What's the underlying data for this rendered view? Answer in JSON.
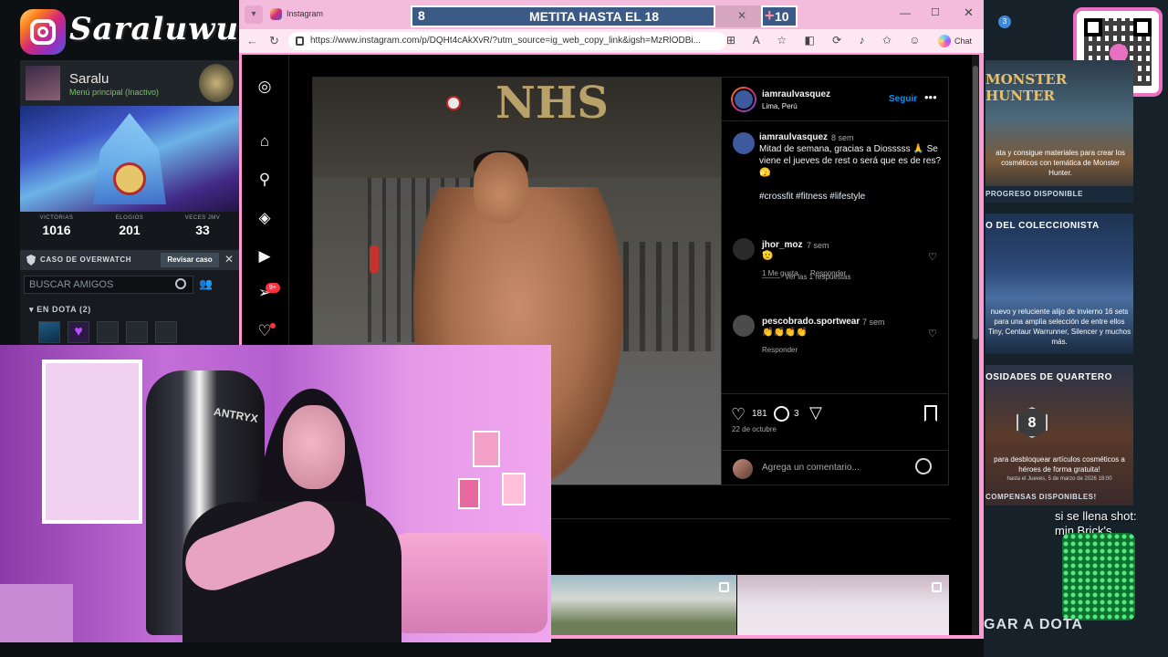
{
  "streamer": {
    "name": "Saraluwux"
  },
  "dota": {
    "profile_name": "Saralu",
    "status": "Menú principal (Inactivo)",
    "stats": [
      {
        "label": "VICTORIAS",
        "value": "1016"
      },
      {
        "label": "ELOGIOS",
        "value": "201"
      },
      {
        "label": "VECES JMV",
        "value": "33"
      }
    ],
    "overwatch_label": "CASO DE OVERWATCH",
    "overwatch_button": "Revisar caso",
    "search_placeholder": "BUSCAR AMIGOS",
    "friend_group": "EN DOTA (2)"
  },
  "counter": {
    "current": "8",
    "title": "METITA HASTA EL 18",
    "goal": "10",
    "close": "✕",
    "plus": "+"
  },
  "browser": {
    "tab_title": "Instagram",
    "url": "https://www.instagram.com/p/DQHt4cAkXvR/?utm_source=ig_web_copy_link&igsh=MzRlODBi...",
    "copilot_label": "Chat"
  },
  "post": {
    "username": "iamraulvasquez",
    "location": "Lima, Perú",
    "follow_label": "Seguir",
    "caption_user": "iamraulvasquez",
    "caption_time": "8 sem",
    "caption_text": "Mitad de semana, gracias a Diosssss 🙏 Se viene el jueves de rest o será que es de res? 🫣",
    "caption_tags": "#crossfit #fitness #lifestyle",
    "comments": [
      {
        "user": "jhor_moz",
        "time": "7 sem",
        "text": "🫡",
        "likes": "1 Me gusta",
        "reply": "Responder",
        "replies": "Ver las 1 respuestas"
      },
      {
        "user": "pescobrado.sportwear",
        "time": "7 sem",
        "text": "👏👏👏👏",
        "reply": "Responder"
      }
    ],
    "like_count": "181",
    "comment_count": "3",
    "date": "22 de octubre",
    "add_comment_placeholder": "Agrega un comentario...",
    "photo_logo": "NHS"
  },
  "instagram_nav": {
    "notification_badge": "9+"
  },
  "right_panels": {
    "notif_count": "3",
    "monster_title": "MONSTER HUNTER",
    "monster_text": "ata y consigue materiales para crear los cosméticos con temática de Monster Hunter.",
    "monster_footer": "PROGRESO DISPONIBLE",
    "collector_title": "O DEL COLECCIONISTA",
    "collector_text": "nuevo y reluciente alijo de invierno 16 sets para una amplia selección de entre ellos Tiny, Centaur Warrunner, Silencer y muchos más.",
    "quartermaster_title": "OSIDADES DE QUARTERO",
    "quartermaster_badge": "8",
    "quartermaster_text": "para desbloquear artículos cosméticos a héroes de forma gratuita!",
    "quartermaster_date": "hasta el  Jueves, 5 de marzo de 2026 18:00",
    "quartermaster_footer": "COMPENSAS DISPONIBLES!",
    "shot_label": "si se llena shot: min Brick's",
    "banner": "GAR A DOTA"
  },
  "chair_brand": "ANTRYX"
}
